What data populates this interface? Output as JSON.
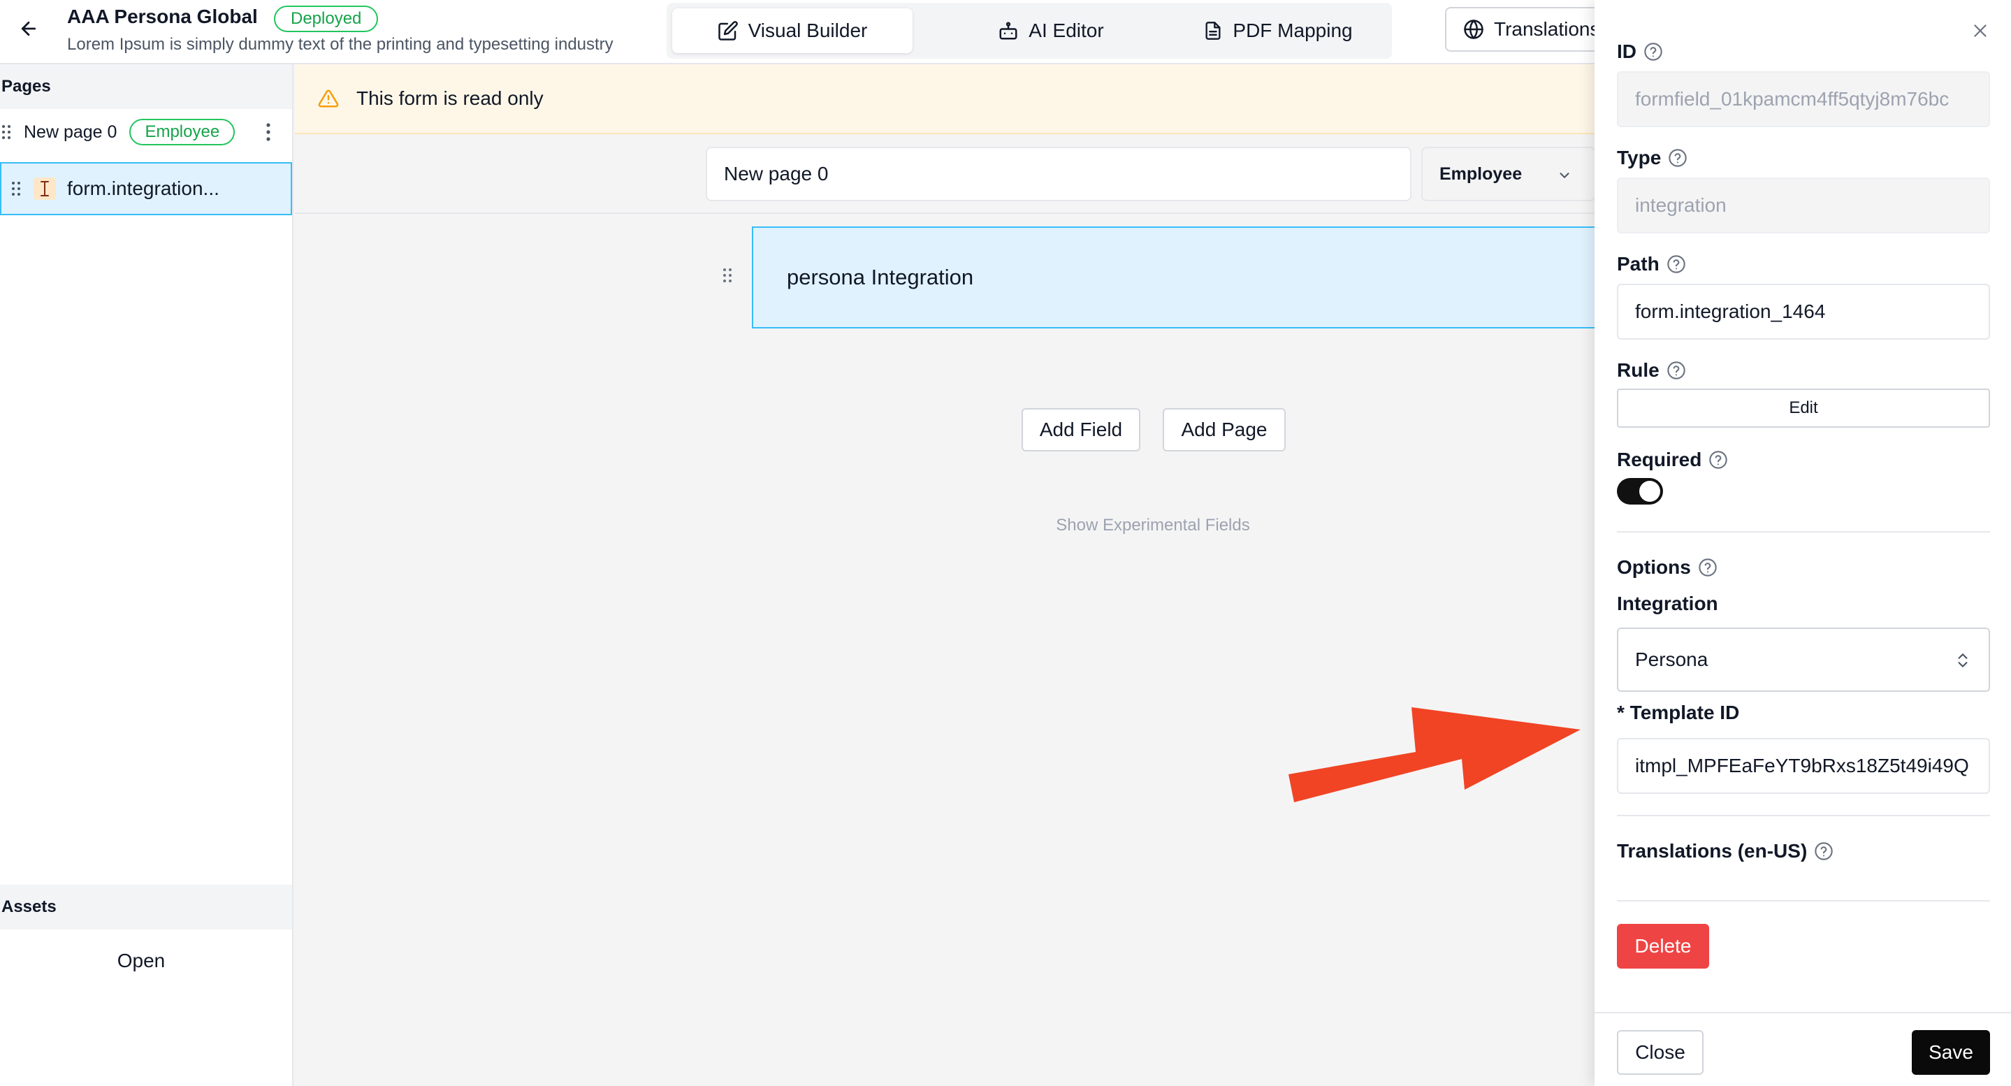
{
  "colors": {
    "accent_blue": "#38bdf8",
    "selection_bg": "#e0f2fe",
    "deployed_green": "#16a34a",
    "warning_bg": "#fef7e8",
    "warning_icon": "#f59e0b",
    "danger": "#ef4444",
    "annotation_arrow": "#f04424",
    "primary_dark": "#0a0a0a"
  },
  "header": {
    "back_icon": "arrow-left-icon",
    "title": "AAA Persona Global",
    "status_badge": "Deployed",
    "subtitle": "Lorem Ipsum is simply dummy text of the printing and typesetting industry",
    "tabs": [
      {
        "label": "Visual Builder",
        "icon": "edit-icon",
        "active": true
      },
      {
        "label": "AI Editor",
        "icon": "bot-icon",
        "active": false
      },
      {
        "label": "PDF Mapping",
        "icon": "file-text-icon",
        "active": false
      }
    ],
    "translations_label": "Translations",
    "translations_icon": "globe-icon"
  },
  "sidebar": {
    "pages_heading": "Pages",
    "pages": [
      {
        "label": "New page 0",
        "badge": "Employee",
        "fields": [
          {
            "label": "form.integration...",
            "icon": "text-cursor-icon",
            "selected": true
          }
        ]
      }
    ],
    "assets_heading": "Assets",
    "assets_open_label": "Open"
  },
  "canvas": {
    "readonly_banner": "This form is read only",
    "page_name_value": "New page 0",
    "role_select_value": "Employee",
    "field_card_label": "persona Integration",
    "add_field_label": "Add Field",
    "add_page_label": "Add Page",
    "show_experimental_label": "Show Experimental Fields"
  },
  "panel": {
    "id_label": "ID",
    "id_value": "formfield_01kpamcm4ff5qtyj8m76bc",
    "type_label": "Type",
    "type_value": "integration",
    "path_label": "Path",
    "path_value": "form.integration_1464",
    "rule_label": "Rule",
    "rule_button": "Edit",
    "required_label": "Required",
    "required_on": true,
    "options_label": "Options",
    "integration_label": "Integration",
    "integration_value": "Persona",
    "template_id_label": "* Template ID",
    "template_id_value": "itmpl_MPFEaFeYT9bRxs18Z5t49i49Q",
    "translations_label": "Translations (en-US)",
    "delete_label": "Delete",
    "close_label": "Close",
    "save_label": "Save"
  }
}
